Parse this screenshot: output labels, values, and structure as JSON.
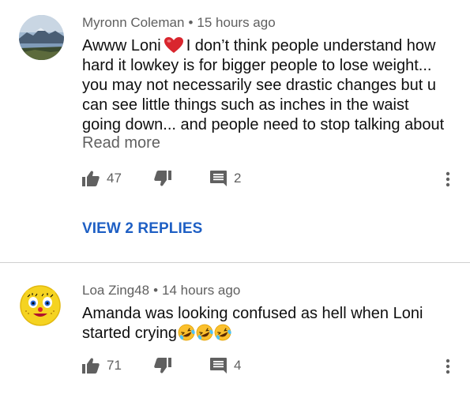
{
  "comments": [
    {
      "author": "Myronn Coleman",
      "separator": "•",
      "time": "15 hours ago",
      "text_lines": [
        "I don’t think people understand how",
        "hard it lowkey is for bigger people to lose weight...",
        "you may not necessarily see drastic changes but u",
        "can see little things such as inches in the waist",
        "going down... and people need to stop talking about"
      ],
      "text_prefix": "Awww Loni",
      "read_more": "Read more",
      "likes": "47",
      "replies_count": "2",
      "view_replies": "VIEW 2 REPLIES",
      "avatar_icon": "mountain-landscape-avatar"
    },
    {
      "author": "Loa Zing48",
      "separator": "•",
      "time": "14 hours ago",
      "text_lines": [
        "Amanda was looking confused as hell when Loni",
        "started crying"
      ],
      "likes": "71",
      "replies_count": "4",
      "avatar_icon": "cartoon-face-avatar",
      "emoji_icon": "rolling-laughing-emoji"
    }
  ],
  "colors": {
    "link": "#1e5fc4",
    "meta": "#606060",
    "icon": "#606060"
  }
}
